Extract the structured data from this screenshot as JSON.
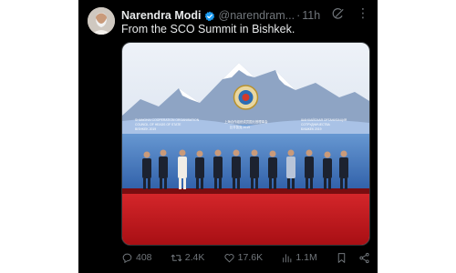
{
  "tweet": {
    "display_name": "Narendra Modi",
    "handle": "@narendram...",
    "separator": "·",
    "time": "11h",
    "text": "From the SCO Summit in Bishkek.",
    "verified": true,
    "more_icon": "⋮"
  },
  "media": {
    "banner_left_lines": [
      "SHANGHAI COOPERATION ORGANISATION",
      "COUNCIL OF HEADS OF STATE",
      "BISHKEK 2019"
    ],
    "banner_center_lines": [
      "上海合作组织成员国元首理事会",
      "比什凯克 2019"
    ],
    "banner_right_lines": [
      "ШАНХАЙСКАЯ ОРГАНИЗАЦИЯ",
      "СОТРУДНИЧЕСТВА",
      "БИШКЕК 2019"
    ]
  },
  "actions": {
    "replies": "408",
    "reposts": "2.4K",
    "likes": "17.6K",
    "views": "1.1M"
  },
  "colors": {
    "background": "#000000",
    "text_primary": "#e7e9ea",
    "text_secondary": "#71767b",
    "verified": "#1d9bf0",
    "carpet": "#c4161c"
  },
  "icons": [
    "avatar",
    "verified-badge-icon",
    "grok-icon",
    "more-icon",
    "reply-icon",
    "repost-icon",
    "like-icon",
    "views-icon",
    "bookmark-icon",
    "share-icon"
  ]
}
